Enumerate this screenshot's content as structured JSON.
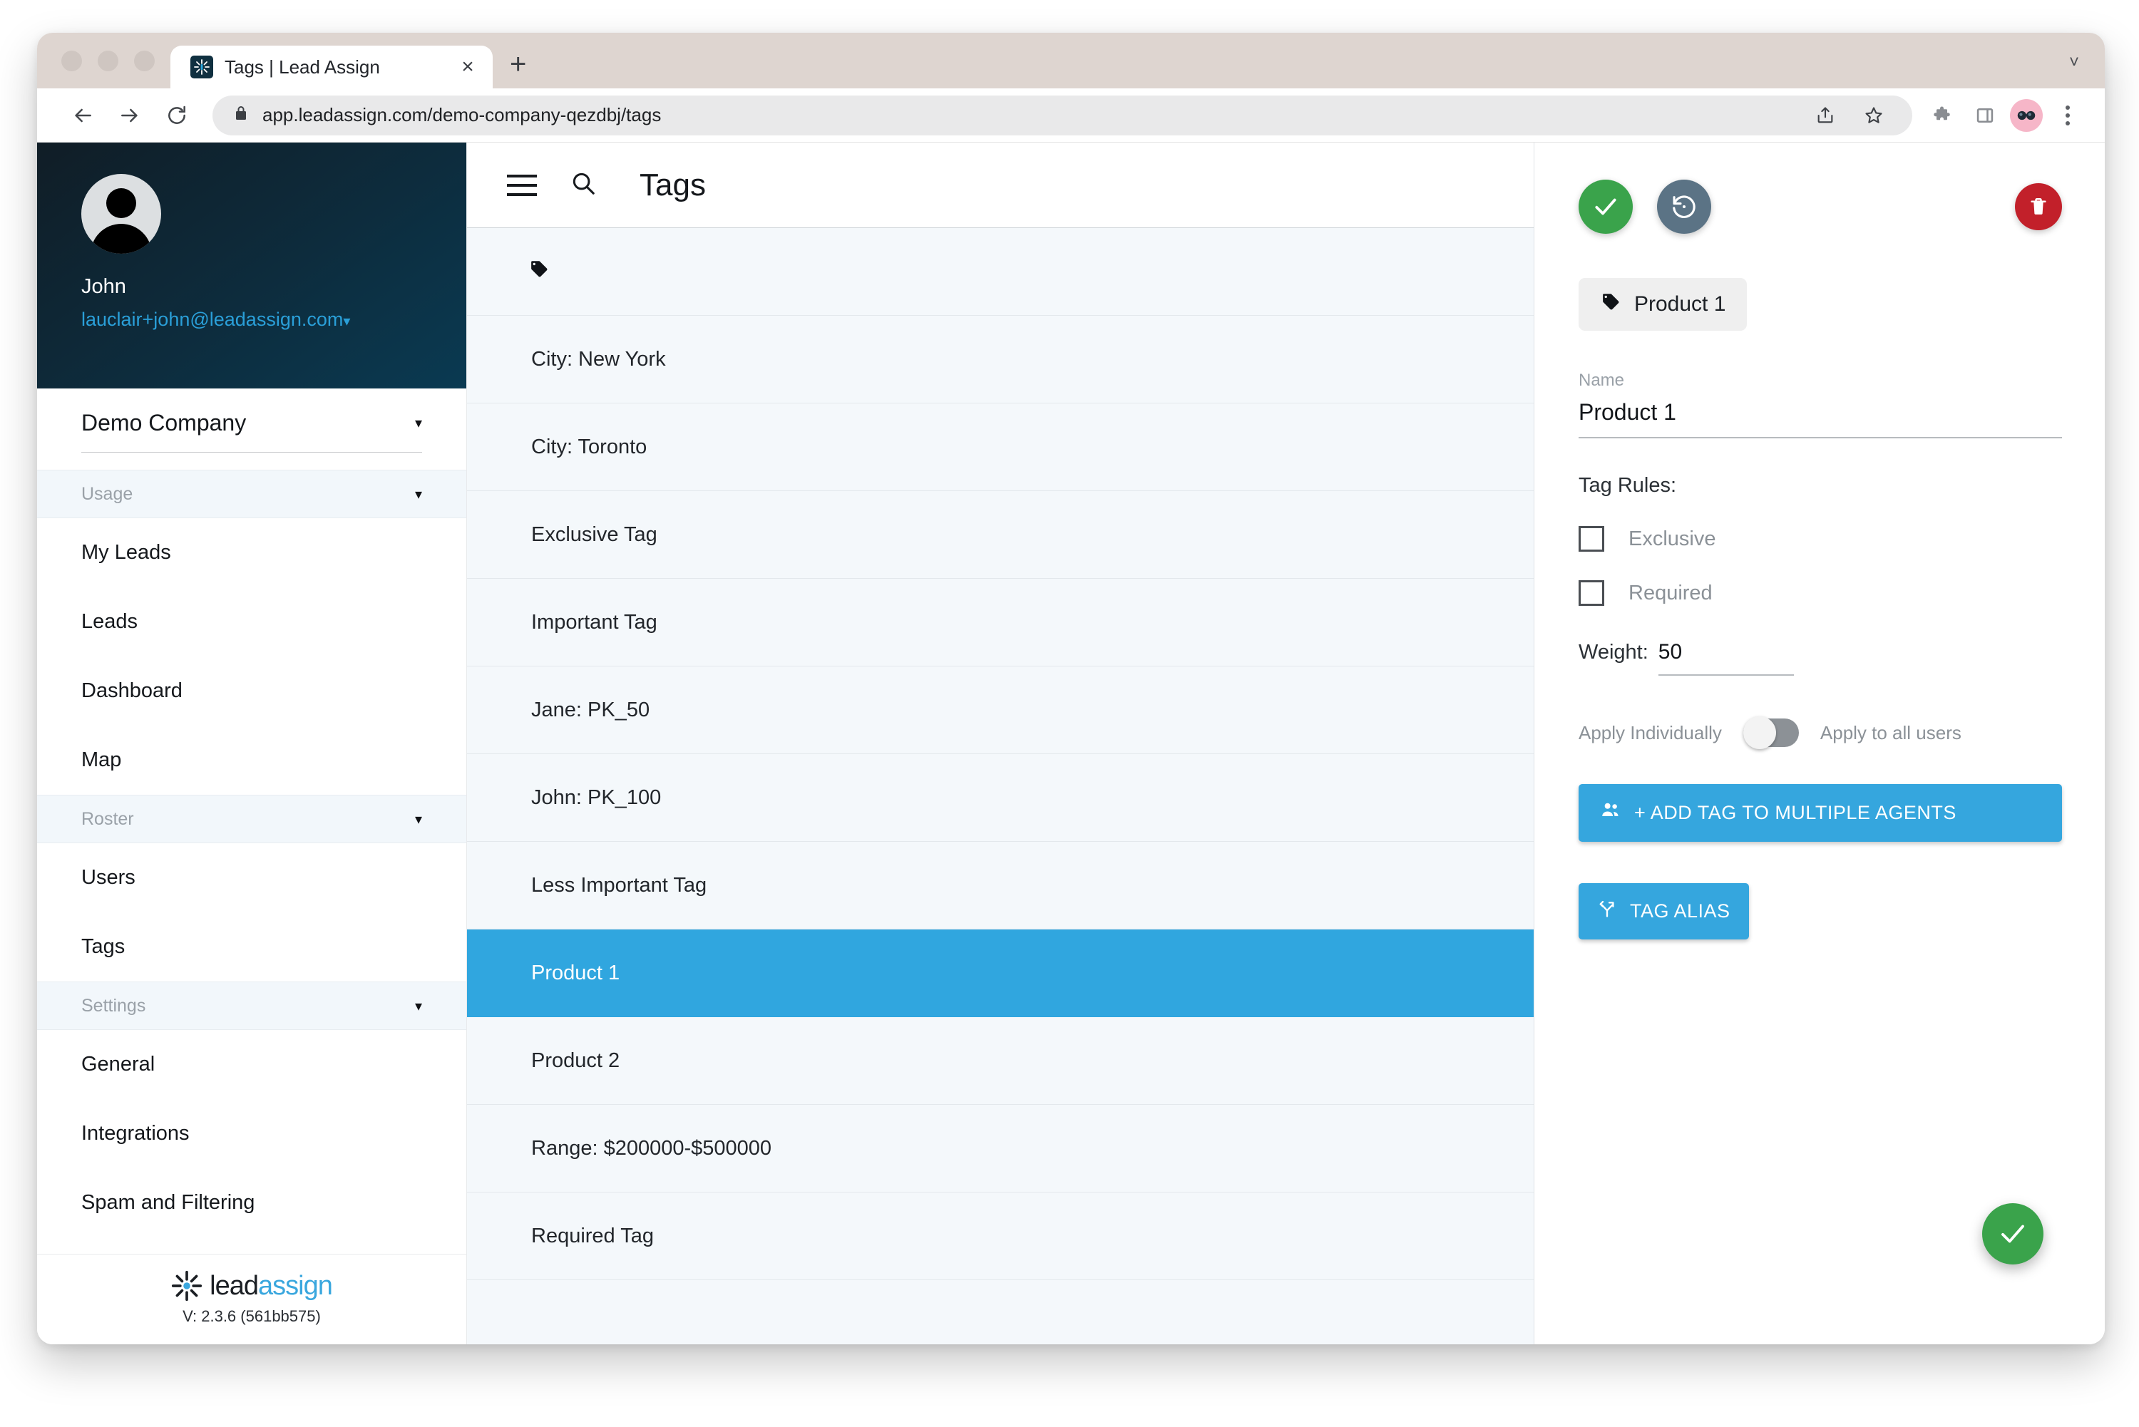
{
  "browser": {
    "tab_title": "Tags | Lead Assign",
    "tab_close_label": "×",
    "new_tab_label": "+",
    "tabstrip_chevron": "˅",
    "url": "app.leadassign.com/demo-company-qezdbj/tags",
    "icons": {
      "back": "back-arrow-icon",
      "forward": "forward-arrow-icon",
      "reload": "reload-icon",
      "lock": "lock-icon",
      "share": "share-icon",
      "bookmark": "star-icon",
      "extensions": "puzzle-piece-icon",
      "sidepanel": "side-panel-icon",
      "profile": "profile-avatar-icon",
      "menu": "kebab-menu-icon"
    }
  },
  "sidebar": {
    "user": {
      "name": "John",
      "email": "lauclair+john@leadassign.com",
      "email_caret": "▾"
    },
    "company": {
      "name": "Demo Company",
      "caret": "▾"
    },
    "groups": [
      {
        "label": "Usage",
        "caret": "▾",
        "items": [
          "My Leads",
          "Leads",
          "Dashboard",
          "Map"
        ]
      },
      {
        "label": "Roster",
        "caret": "▾",
        "items": [
          "Users",
          "Tags"
        ]
      },
      {
        "label": "Settings",
        "caret": "▾",
        "items": [
          "General",
          "Integrations",
          "Spam and Filtering"
        ]
      }
    ],
    "footer": {
      "brand_first": "lead",
      "brand_second": "assign",
      "version": "V: 2.3.6 (561bb575)"
    }
  },
  "main": {
    "title": "Tags",
    "menu_icon": "hamburger-menu-icon",
    "search_icon": "search-icon",
    "header_tag_icon": "tag-icon",
    "tags": [
      "City: New York",
      "City: Toronto",
      "Exclusive Tag",
      "Important Tag",
      "Jane: PK_50",
      "John: PK_100",
      "Less Important Tag",
      "Product 1",
      "Product 2",
      "Range: $200000-$500000",
      "Required Tag"
    ],
    "selected_tag": "Product 1"
  },
  "panel": {
    "save_icon": "checkmark-icon",
    "revert_icon": "history-restore-icon",
    "delete_icon": "trash-icon",
    "chip": {
      "icon": "tag-icon",
      "label": "Product 1"
    },
    "name_label": "Name",
    "name_value": "Product 1",
    "rules_title": "Tag Rules:",
    "rules": [
      {
        "label": "Exclusive",
        "checked": false
      },
      {
        "label": "Required",
        "checked": false
      }
    ],
    "weight_label": "Weight:",
    "weight_value": "50",
    "toggle_left_label": "Apply Individually",
    "toggle_right_label": "Apply to all users",
    "toggle_state": "left",
    "add_agents_button": "+ ADD TAG TO MULTIPLE AGENTS",
    "add_agents_icon": "people-icon",
    "tag_alias_button": "TAG ALIAS",
    "tag_alias_icon": "branch-alias-icon",
    "fab_icon": "checkmark-icon"
  },
  "colors": {
    "accent_blue": "#30a6df",
    "success_green": "#3aa34b",
    "danger_red": "#c2202a",
    "slate": "#5b7385",
    "sidebar_dark": "#0d2c3d",
    "list_bg": "#f4f8fb"
  }
}
